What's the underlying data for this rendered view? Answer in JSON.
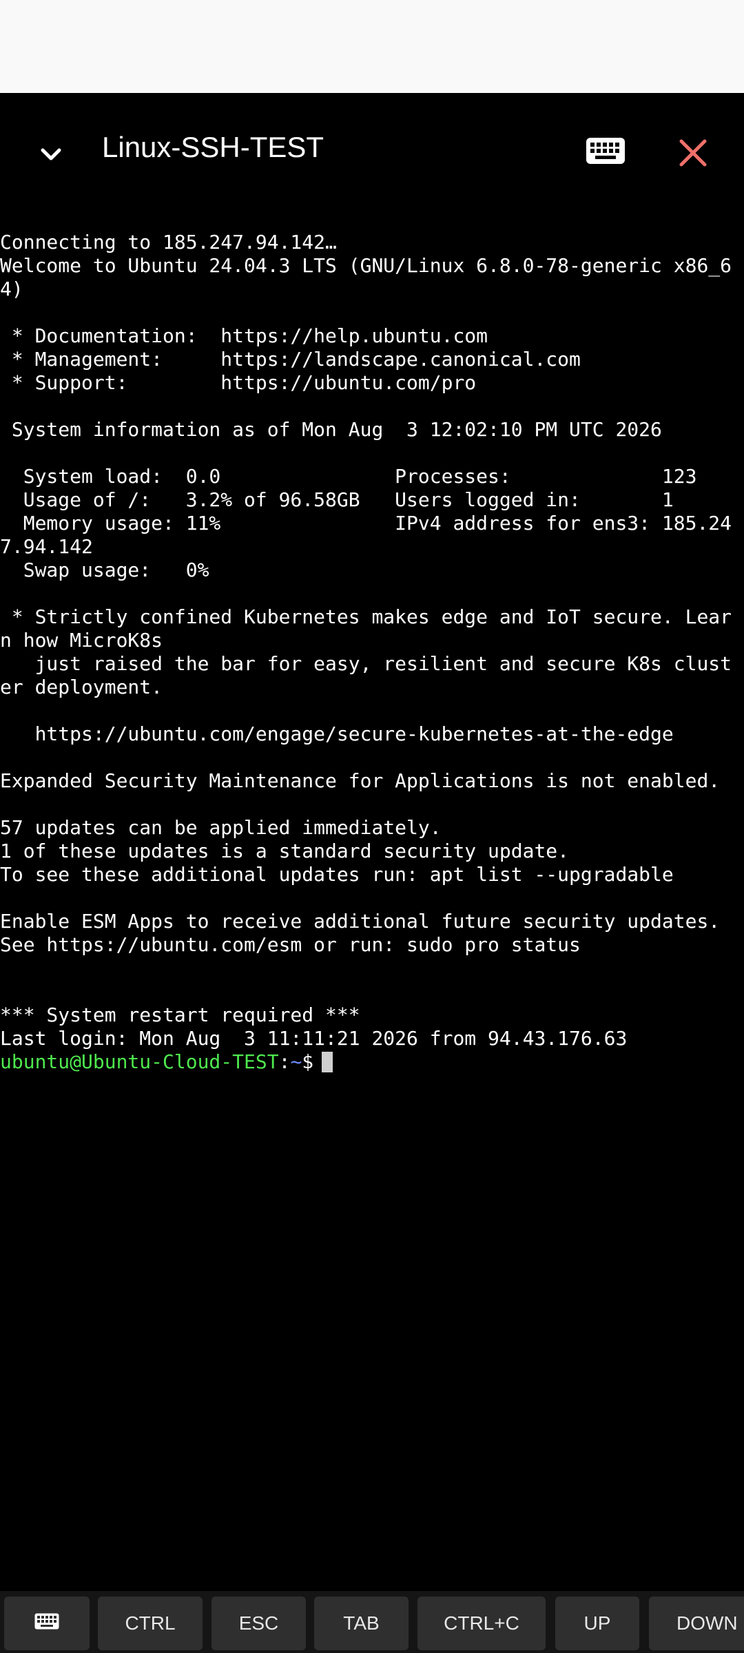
{
  "header": {
    "title": "Linux-SSH-TEST"
  },
  "terminal": {
    "lines": [
      "Connecting to 185.247.94.142…",
      "Welcome to Ubuntu 24.04.3 LTS (GNU/Linux 6.8.0-78-generic x86_6",
      "4)",
      "",
      " * Documentation:  https://help.ubuntu.com",
      " * Management:     https://landscape.canonical.com",
      " * Support:        https://ubuntu.com/pro",
      "",
      " System information as of Mon Aug  3 12:02:10 PM UTC 2026",
      "",
      "  System load:  0.0               Processes:             123",
      "  Usage of /:   3.2% of 96.58GB   Users logged in:       1",
      "  Memory usage: 11%               IPv4 address for ens3: 185.24",
      "7.94.142",
      "  Swap usage:   0%",
      "",
      " * Strictly confined Kubernetes makes edge and IoT secure. Lear",
      "n how MicroK8s",
      "   just raised the bar for easy, resilient and secure K8s clust",
      "er deployment.",
      "",
      "   https://ubuntu.com/engage/secure-kubernetes-at-the-edge",
      "",
      "Expanded Security Maintenance for Applications is not enabled.",
      "",
      "57 updates can be applied immediately.",
      "1 of these updates is a standard security update.",
      "To see these additional updates run: apt list --upgradable",
      "",
      "Enable ESM Apps to receive additional future security updates.",
      "See https://ubuntu.com/esm or run: sudo pro status",
      "",
      "",
      "*** System restart required ***",
      "Last login: Mon Aug  3 11:11:21 2026 from 94.43.176.63"
    ],
    "prompt": {
      "user_host": "ubuntu@Ubuntu-Cloud-TEST",
      "colon": ":",
      "path": "~",
      "symbol": "$"
    }
  },
  "keybar": {
    "keyboard_icon": "keyboard-icon",
    "ctrl": "CTRL",
    "esc": "ESC",
    "tab": "TAB",
    "ctrl_c": "CTRL+C",
    "up": "UP",
    "down": "DOWN"
  },
  "colors": {
    "background": "#000000",
    "status_area": "#f9f9f9",
    "close_icon": "#f0706a",
    "prompt_user": "#4ee84e",
    "prompt_path": "#6b8cff",
    "key_bg": "#2f2f2f"
  }
}
